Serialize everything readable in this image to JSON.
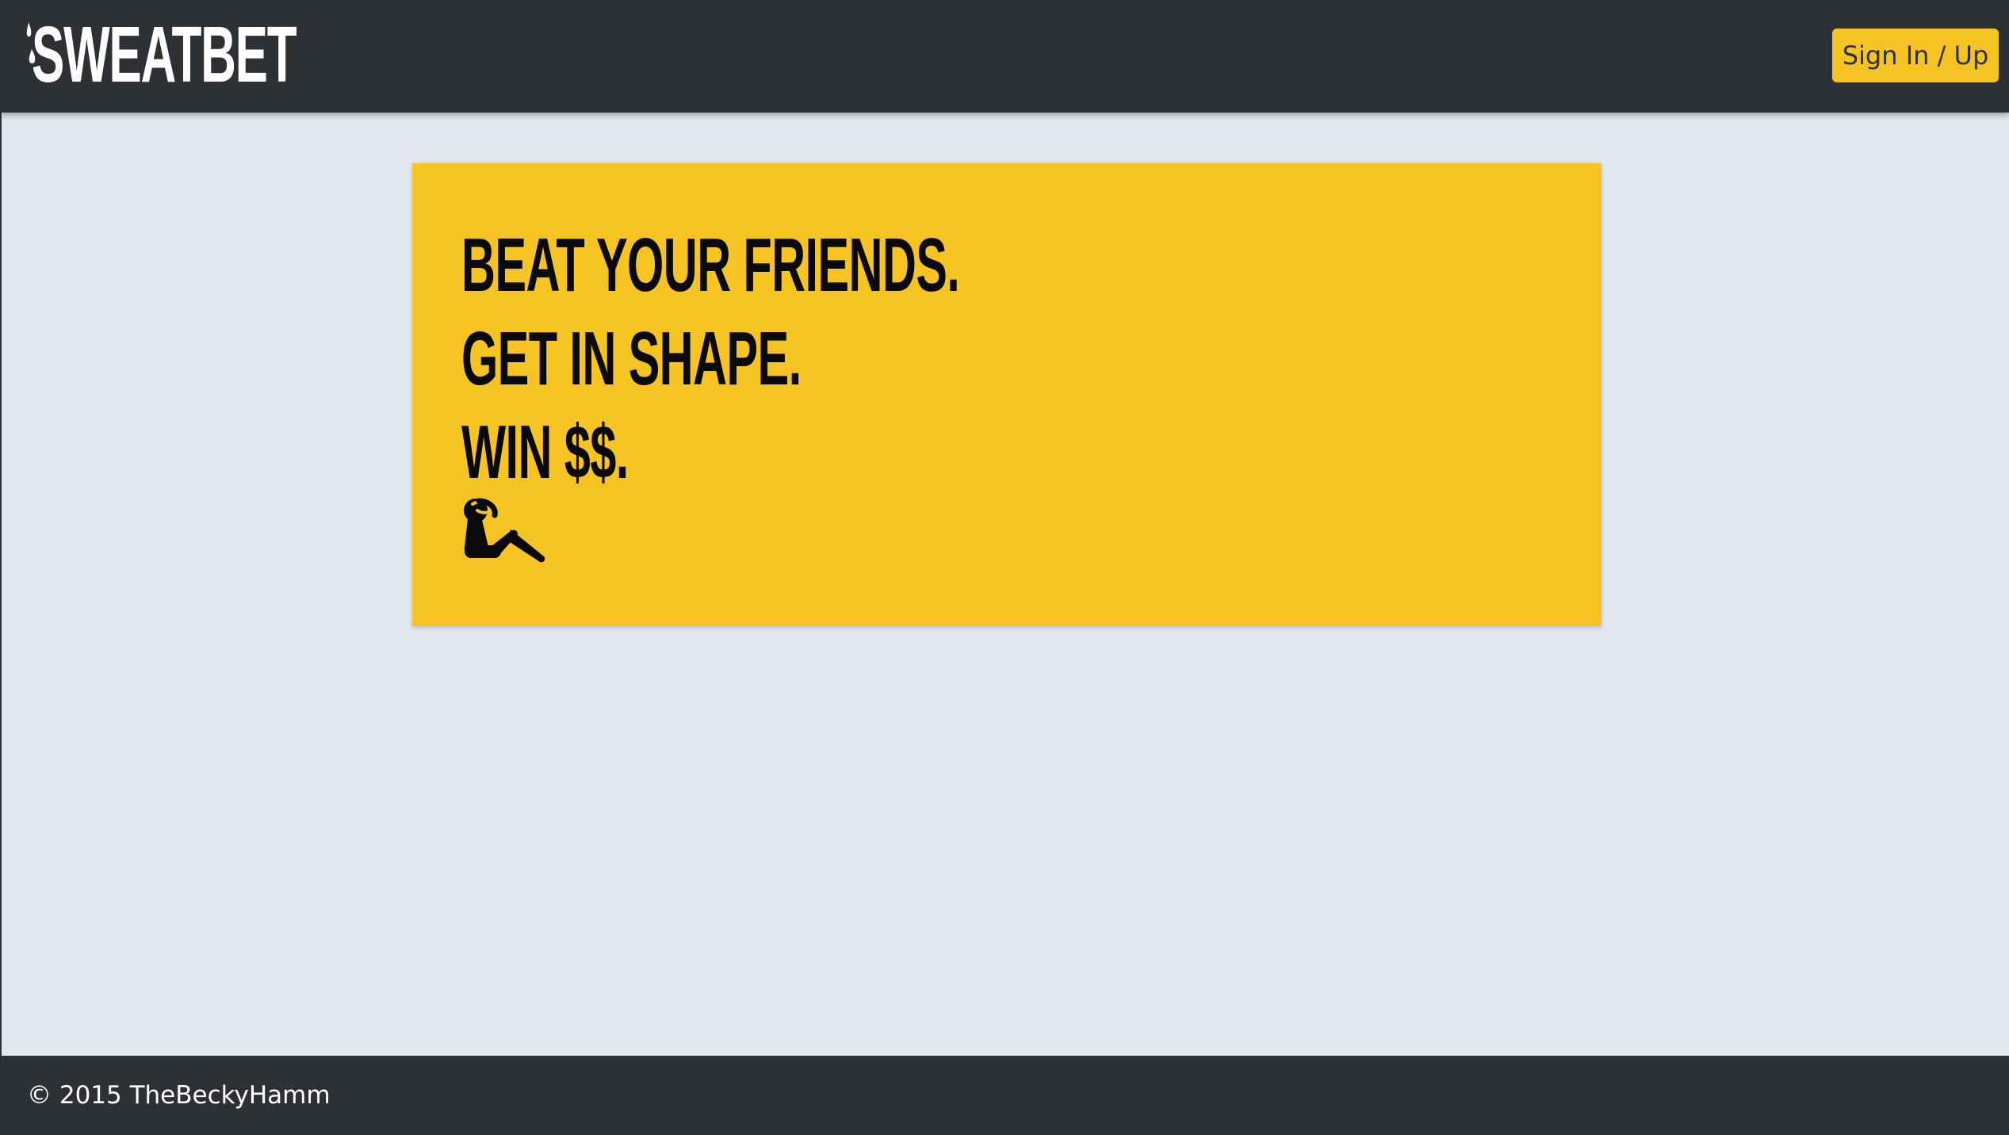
{
  "header": {
    "logo_text": "SWEATBET",
    "signin_label": "Sign In / Up"
  },
  "hero": {
    "lines": [
      "BEAT YOUR FRIENDS.",
      "GET IN SHAPE.",
      "WIN $$."
    ],
    "icon": "situp-figure-icon"
  },
  "footer": {
    "copyright": "© 2015 TheBeckyHamm"
  },
  "colors": {
    "bar": "#2d3034",
    "accent": "#f6c422",
    "background": "#e3e8f0",
    "text_dark": "#0a0a0a"
  }
}
